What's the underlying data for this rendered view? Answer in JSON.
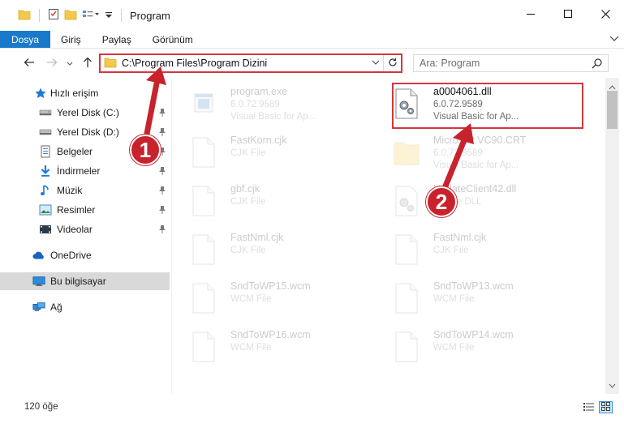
{
  "window": {
    "title": "Program",
    "controls": {
      "minimize": "minimize-icon",
      "maximize": "maximize-icon",
      "close": "close-icon"
    }
  },
  "ribbon": {
    "tabs": [
      {
        "label": "Dosya",
        "active": true
      },
      {
        "label": "Giriş"
      },
      {
        "label": "Paylaş"
      },
      {
        "label": "Görünüm"
      }
    ]
  },
  "address": {
    "path": "C:\\Program Files\\Program Dizini",
    "search_placeholder": "Ara: Program"
  },
  "sidebar": {
    "items": [
      {
        "label": "Hızlı erişim",
        "icon": "star-icon",
        "pinned": false
      },
      {
        "label": "Yerel Disk (C:)",
        "icon": "drive-icon",
        "pinned": true
      },
      {
        "label": "Yerel Disk (D:)",
        "icon": "drive-icon",
        "pinned": true
      },
      {
        "label": "Belgeler",
        "icon": "documents-icon",
        "pinned": true
      },
      {
        "label": "İndirmeler",
        "icon": "download-icon",
        "pinned": true
      },
      {
        "label": "Müzik",
        "icon": "music-icon",
        "pinned": true
      },
      {
        "label": "Resimler",
        "icon": "pictures-icon",
        "pinned": true
      },
      {
        "label": "Videolar",
        "icon": "videos-icon",
        "pinned": true
      },
      {
        "label": "OneDrive",
        "icon": "cloud-icon",
        "pinned": false
      },
      {
        "label": "Bu bilgisayar",
        "icon": "computer-icon",
        "pinned": false,
        "selected": true
      },
      {
        "label": "Ağ",
        "icon": "network-icon",
        "pinned": false
      }
    ]
  },
  "files": [
    {
      "name": "program.exe",
      "line2": "6.0.72.9589",
      "line3": "Visual Basic for Ap...",
      "icon": "exe-icon",
      "dim": true
    },
    {
      "name": "a0004061.dll",
      "line2": "6.0.72.9589",
      "line3": "Visual Basic for Ap...",
      "icon": "dll-gear-icon",
      "dim": false,
      "highlighted": true
    },
    {
      "name": "FastKorn.cjk",
      "line2": "CJK File",
      "line3": "",
      "icon": "blank-file-icon",
      "dim": true
    },
    {
      "name": "Microsoft.VC90.CRT",
      "line2": "6.0.72.9589",
      "line3": "Visual Basic for Ap...",
      "icon": "folder-icon",
      "dim": true
    },
    {
      "name": "gbf.cjk",
      "line2": "CJK File",
      "line3": "",
      "icon": "blank-file-icon",
      "dim": true
    },
    {
      "name": "UpdateClient42.dll",
      "line2": "Device DLL",
      "line3": "",
      "icon": "dll-gear-icon",
      "dim": true
    },
    {
      "name": "FastNml.cjk",
      "line2": "CJK File",
      "line3": "",
      "icon": "blank-file-icon",
      "dim": true
    },
    {
      "name": "FastNml.cjk",
      "line2": "CJK File",
      "line3": "",
      "icon": "blank-file-icon",
      "dim": true
    },
    {
      "name": "SndToWP15.wcm",
      "line2": "WCM File",
      "line3": "",
      "icon": "blank-file-icon",
      "dim": true
    },
    {
      "name": "SndToWP13.wcm",
      "line2": "WCM File",
      "line3": "",
      "icon": "blank-file-icon",
      "dim": true
    },
    {
      "name": "SndToWP16.wcm",
      "line2": "WCM File",
      "line3": "",
      "icon": "blank-file-icon",
      "dim": true
    },
    {
      "name": "SndToWP14.wcm",
      "line2": "WCM File",
      "line3": "",
      "icon": "blank-file-icon",
      "dim": true
    }
  ],
  "status": {
    "item_count": "120 öğe"
  },
  "annotations": [
    {
      "number": "1",
      "color": "#c8232d"
    },
    {
      "number": "2",
      "color": "#c8232d"
    }
  ],
  "colors": {
    "accent": "#1979ca",
    "highlight": "#d4363e",
    "selection": "#cce8ff"
  }
}
